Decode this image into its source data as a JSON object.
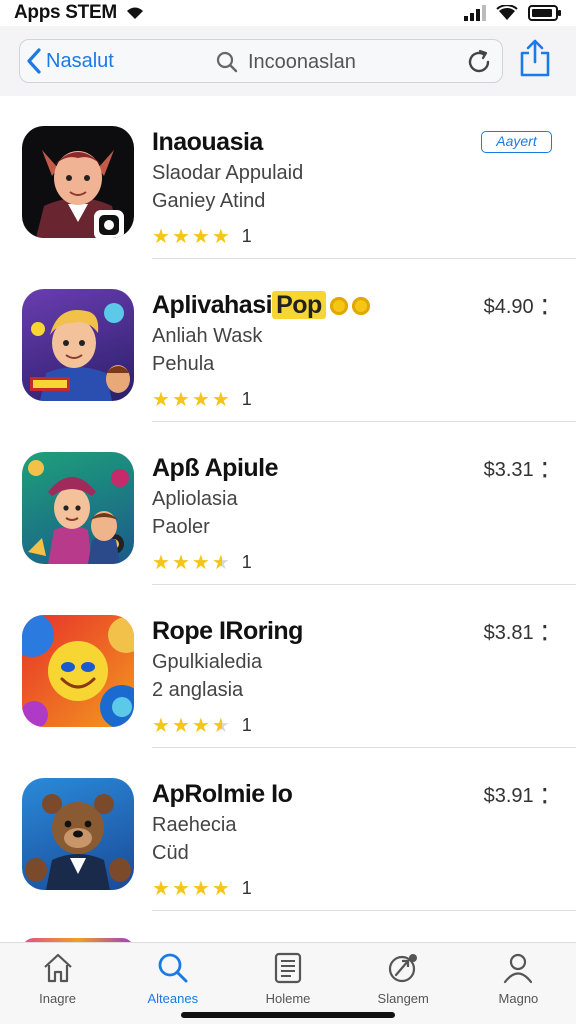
{
  "status_bar": {
    "title": "Apps STEM",
    "icons": [
      "wifi-icon",
      "signal-icon",
      "battery-icon"
    ]
  },
  "nav": {
    "back_label": "Nasalut",
    "search_text": "Incoonaslan",
    "icons": [
      "chevron-left-icon",
      "search-icon",
      "reload-icon",
      "share-icon"
    ]
  },
  "apps": [
    {
      "name": "Inaouasia",
      "name_badge": "",
      "subtitle1": "Slaodar Appulaid",
      "subtitle2": "Ganiey Atind",
      "rating": 4,
      "rating_count": "1",
      "price": "",
      "action_label": "Aayert",
      "icon": "elf-character-icon",
      "accent": "#7a2a2e"
    },
    {
      "name": "Aplivahasi",
      "name_badge": "Pop",
      "subtitle1": "Anliah Wask",
      "subtitle2": "Pehula",
      "rating": 4,
      "rating_count": "1",
      "price": "$4.90",
      "action_label": "",
      "icon": "boy-character-icon",
      "accent": "#5a2d8c"
    },
    {
      "name": "Apß Apiule",
      "name_badge": "",
      "subtitle1": "Apliolasia",
      "subtitle2": "Paoler",
      "rating": 3.5,
      "rating_count": "1",
      "price": "$3.31",
      "action_label": "",
      "icon": "pirate-characters-icon",
      "accent": "#1e8a6a"
    },
    {
      "name": "Rope IRoring",
      "name_badge": "",
      "subtitle1": "Gpulkialedia",
      "subtitle2": "2 anglasia",
      "rating": 3.5,
      "rating_count": "1",
      "price": "$3.81",
      "action_label": "",
      "icon": "smiley-bubble-icon",
      "accent": "#f5c518"
    },
    {
      "name": "ApRolmie Io",
      "name_badge": "",
      "subtitle1": "Raehecia",
      "subtitle2": "Cüd",
      "rating": 4,
      "rating_count": "1",
      "price": "$3.91",
      "action_label": "",
      "icon": "bear-character-icon",
      "accent": "#1f5aa6"
    }
  ],
  "tabs": [
    {
      "label": "Inagre",
      "icon": "house-icon",
      "active": false
    },
    {
      "label": "Alteanes",
      "icon": "search-icon",
      "active": true
    },
    {
      "label": "Holeme",
      "icon": "list-icon",
      "active": false
    },
    {
      "label": "Slangem",
      "icon": "rocket-icon",
      "active": false
    },
    {
      "label": "Magno",
      "icon": "person-icon",
      "active": false
    }
  ],
  "colors": {
    "accent": "#1a7ae8",
    "star": "#f5c518"
  }
}
